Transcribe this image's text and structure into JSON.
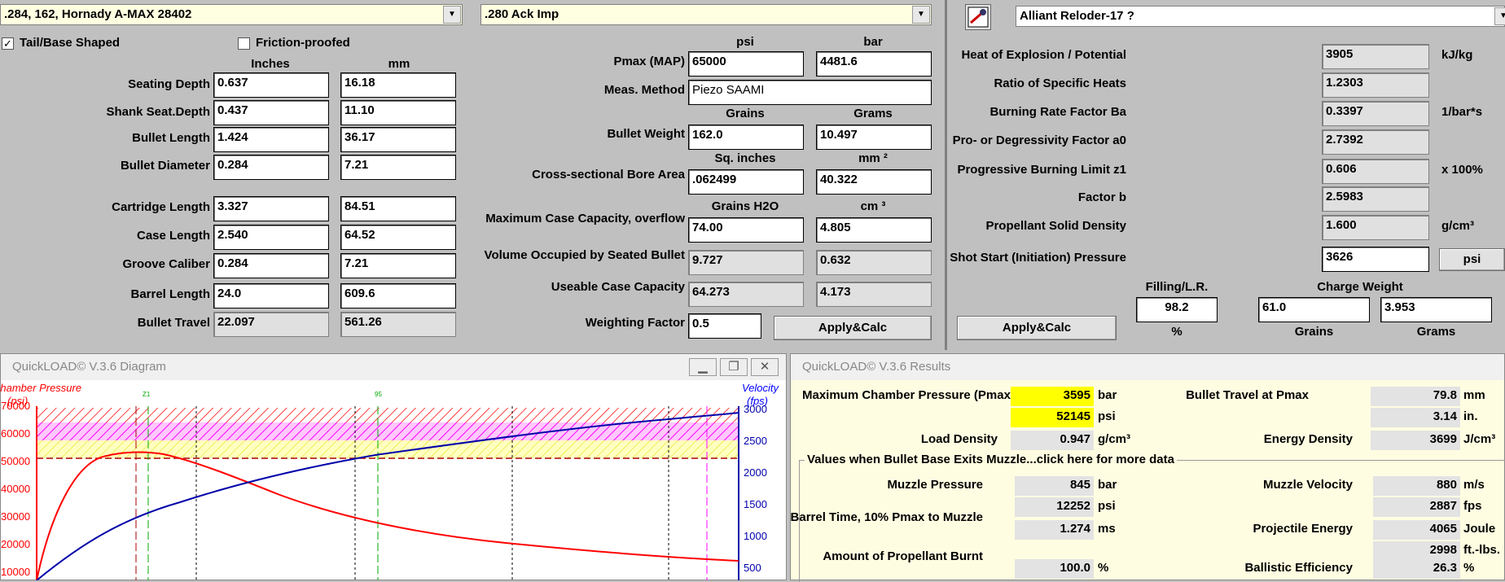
{
  "top_left": {
    "bullet_combo": ".284, 162, Hornady A-MAX 28402",
    "cartridge_combo": ".280 Ack Imp",
    "tail_base_label": "Tail/Base Shaped",
    "tail_base_checked": "✓",
    "friction_label": "Friction-proofed",
    "col_inches": "Inches",
    "col_mm": "mm",
    "rows": [
      {
        "label": "Seating Depth",
        "in": "0.637",
        "mm": "16.18"
      },
      {
        "label": "Shank Seat.Depth",
        "in": "0.437",
        "mm": "11.10"
      },
      {
        "label": "Bullet Length",
        "in": "1.424",
        "mm": "36.17"
      },
      {
        "label": "Bullet Diameter",
        "in": "0.284",
        "mm": "7.21"
      },
      {
        "label": "Cartridge Length",
        "in": "3.327",
        "mm": "84.51"
      },
      {
        "label": "Case Length",
        "in": "2.540",
        "mm": "64.52"
      },
      {
        "label": "Groove Caliber",
        "in": "0.284",
        "mm": "7.21"
      },
      {
        "label": "Barrel Length",
        "in": "24.0",
        "mm": "609.6"
      },
      {
        "label": "Bullet Travel",
        "in": "22.097",
        "mm": "561.26"
      }
    ]
  },
  "mid": {
    "col_psi": "psi",
    "col_bar": "bar",
    "pmax_label": "Pmax (MAP)",
    "pmax_psi": "65000",
    "pmax_bar": "4481.6",
    "meas_label": "Meas. Method",
    "meas_value": "Piezo SAAMI",
    "col_grains": "Grains",
    "col_grams": "Grams",
    "weight_label": "Bullet Weight",
    "weight_gr": "162.0",
    "weight_g": "10.497",
    "col_sqin": "Sq. inches",
    "col_mm2": "mm ²",
    "bore_label": "Cross-sectional Bore Area",
    "bore_sqin": ".062499",
    "bore_mm2": "40.322",
    "col_h2o": "Grains H2O",
    "col_cm3": "cm ³",
    "cap_label": "Maximum Case Capacity, overflow",
    "cap_gr": "74.00",
    "cap_cm3": "4.805",
    "vol_label": "Volume Occupied by Seated Bullet",
    "vol_gr": "9.727",
    "vol_cm3": "0.632",
    "use_label": "Useable Case Capacity",
    "use_gr": "64.273",
    "use_cm3": "4.173",
    "wf_label": "Weighting Factor",
    "wf_value": "0.5",
    "apply_label": "Apply&Calc"
  },
  "powder": {
    "combo": "Alliant Reloder-17 ?",
    "rows": [
      {
        "label": "Heat of Explosion / Potential",
        "value": "3905",
        "unit": "kJ/kg"
      },
      {
        "label": "Ratio of Specific Heats",
        "value": "1.2303",
        "unit": ""
      },
      {
        "label": "Burning Rate Factor  Ba",
        "value": "0.3397",
        "unit": "1/bar*s"
      },
      {
        "label": "Pro- or Degressivity Factor  a0",
        "value": "2.7392",
        "unit": ""
      },
      {
        "label": "Progressive Burning Limit z1",
        "value": "0.606",
        "unit": "x 100%"
      },
      {
        "label": "Factor  b",
        "value": "2.5983",
        "unit": ""
      },
      {
        "label": "Propellant Solid Density",
        "value": "1.600",
        "unit": "g/cm³"
      }
    ],
    "shot_label": "Shot Start (Initiation) Pressure",
    "shot_value": "3626",
    "shot_unit_btn": "psi",
    "filling_label": "Filling/L.R.",
    "charge_label": "Charge Weight",
    "filling_value": "98.2",
    "charge_gr": "61.0",
    "charge_g": "3.953",
    "pct": "%",
    "grains": "Grains",
    "grams": "Grams",
    "apply_label": "Apply&Calc"
  },
  "diagram": {
    "title": "QuickLOAD© V.3.6 Diagram",
    "left_title": "Chamber Pressure",
    "left_unit": "(psi)",
    "right_title": "Velocity",
    "right_unit": "(fps)",
    "left_ticks": [
      "70000",
      "60000",
      "50000",
      "40000",
      "30000",
      "20000",
      "10000"
    ],
    "right_ticks": [
      "3000",
      "2500",
      "2000",
      "1500",
      "1000",
      "500"
    ],
    "marker_z1": "Z1",
    "marker_95": "95"
  },
  "results": {
    "title": "QuickLOAD© V.3.6 Results",
    "pmax_label": "Maximum Chamber Pressure (Pmax)",
    "pmax_bar": "3595",
    "pmax_bar_u": "bar",
    "pmax_psi": "52145",
    "pmax_psi_u": "psi",
    "travel_label": "Bullet Travel at Pmax",
    "travel_mm": "79.8",
    "travel_mm_u": "mm",
    "travel_in": "3.14",
    "travel_in_u": "in.",
    "load_label": "Load Density",
    "load_value": "0.947",
    "load_u": "g/cm³",
    "energy_d_label": "Energy Density",
    "energy_d_value": "3699",
    "energy_d_u": "J/cm³",
    "group_label": "Values when Bullet Base Exits Muzzle...click here for more data",
    "muzzle_p_label": "Muzzle Pressure",
    "muzzle_p_bar": "845",
    "muzzle_p_bar_u": "bar",
    "muzzle_p_psi": "12252",
    "muzzle_p_psi_u": "psi",
    "muzzle_v_label": "Muzzle Velocity",
    "muzzle_v_ms": "880",
    "muzzle_v_ms_u": "m/s",
    "muzzle_v_fps": "2887",
    "muzzle_v_fps_u": "fps",
    "barrel_label": "Barrel Time, 10% Pmax to Muzzle",
    "barrel_value": "1.274",
    "barrel_u": "ms",
    "proj_label": "Projectile Energy",
    "proj_j": "4065",
    "proj_j_u": "Joule",
    "proj_ft": "2998",
    "proj_ft_u": "ft.-lbs.",
    "burnt_label": "Amount of Propellant Burnt",
    "burnt_value": "100.0",
    "burnt_u": "%",
    "ball_label": "Ballistic Efficiency",
    "ball_value": "26.3",
    "ball_u": "%"
  }
}
